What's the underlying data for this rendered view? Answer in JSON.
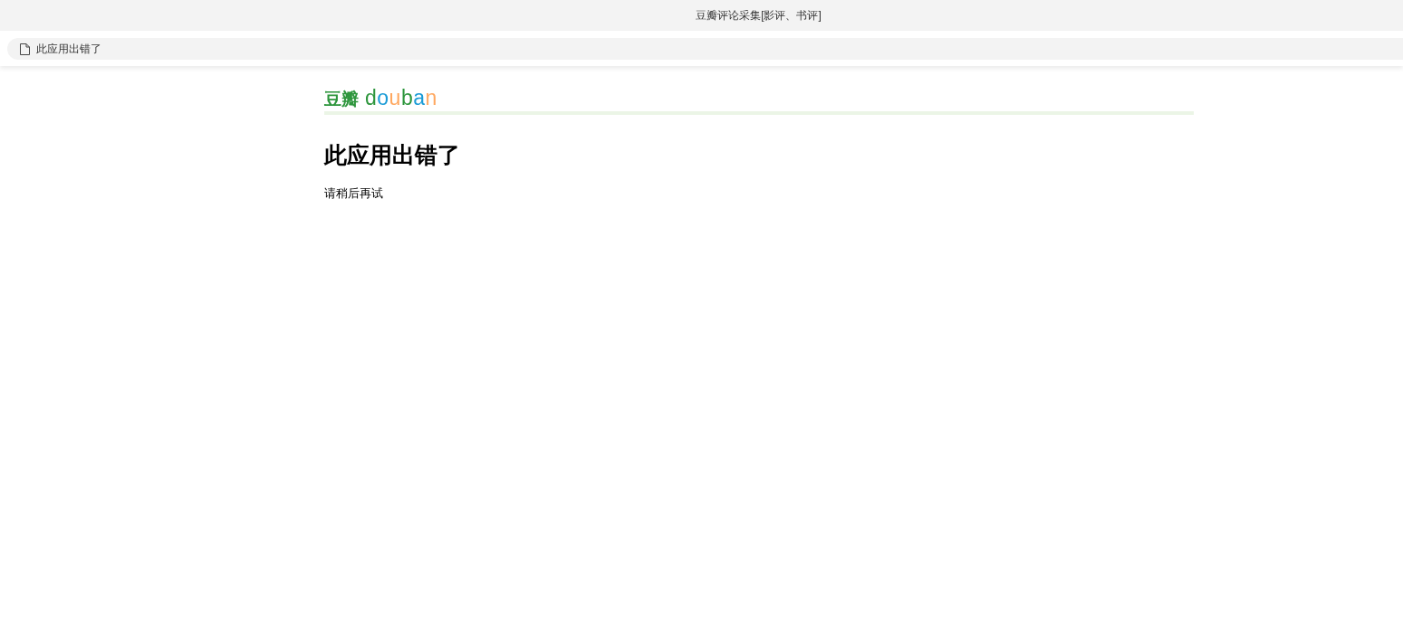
{
  "window": {
    "title": "豆瓣评论采集[影评、书评]"
  },
  "address_bar": {
    "text": "此应用出错了"
  },
  "page": {
    "logo": {
      "mark": "豆瓣",
      "wordmark": [
        {
          "letter": "d",
          "color": "#2e963d"
        },
        {
          "letter": "o",
          "color": "#1a9bd6"
        },
        {
          "letter": "u",
          "color": "#ffa860"
        },
        {
          "letter": "b",
          "color": "#2e963d"
        },
        {
          "letter": "a",
          "color": "#1a9bd6"
        },
        {
          "letter": "n",
          "color": "#ffa860"
        }
      ]
    },
    "heading": "此应用出错了",
    "message": "请稍后再试"
  }
}
